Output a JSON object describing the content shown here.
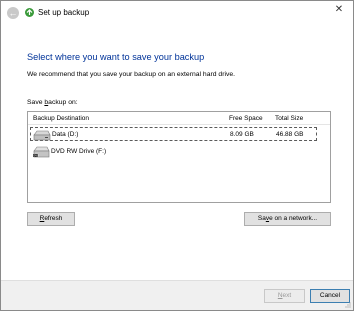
{
  "window": {
    "title": "Set up backup",
    "back_icon": "back-arrow-icon",
    "app_icon": "backup-icon",
    "close_glyph": "✕"
  },
  "content": {
    "heading": "Select where you want to save your backup",
    "subtext": "We recommend that you save your backup on an external hard drive.",
    "save_label": "Save backup on:"
  },
  "list": {
    "columns": [
      "Backup Destination",
      "Free Space",
      "Total Size"
    ],
    "rows": [
      {
        "name": "Data (D:)",
        "free": "8.09 GB",
        "total": "46.88 GB",
        "icon": "hard-drive-icon",
        "selected": true
      },
      {
        "name": "DVD RW Drive (F:)",
        "free": "",
        "total": "",
        "icon": "dvd-drive-icon",
        "selected": false
      }
    ]
  },
  "buttons": {
    "refresh": "Refresh",
    "save_network": "Save on a network...",
    "next": "Next",
    "cancel": "Cancel"
  },
  "colors": {
    "heading": "#003399",
    "footer": "#f0f0f0",
    "button_face": "#e1e1e1"
  }
}
